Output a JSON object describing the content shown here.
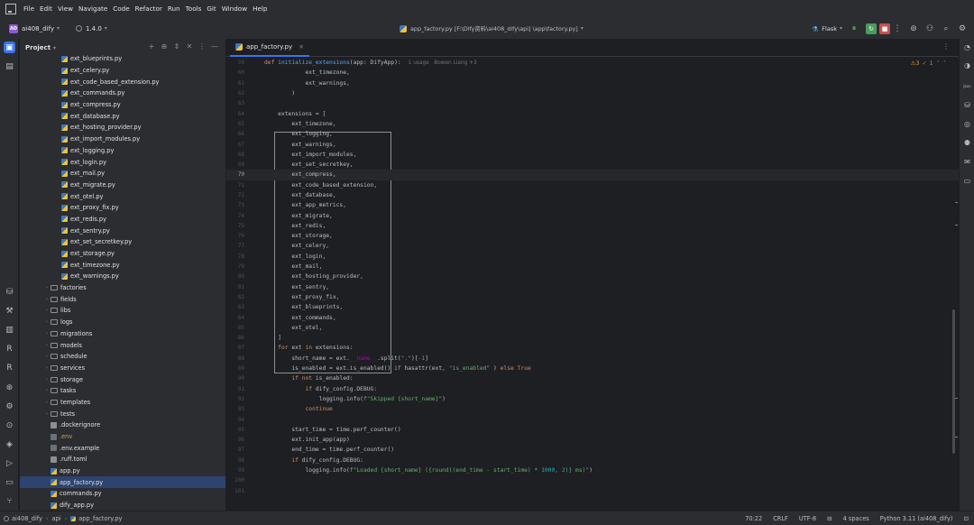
{
  "menu": [
    "File",
    "Edit",
    "View",
    "Navigate",
    "Code",
    "Refactor",
    "Run",
    "Tools",
    "Git",
    "Window",
    "Help"
  ],
  "project": {
    "badge": "AD",
    "name": "ai408_dify",
    "branch": "1.4.0"
  },
  "title_path": "app_factory.py [F:\\Dify资料\\ai408_dify\\api] \\app\\factory.py]",
  "run_config": "Flask",
  "panel": {
    "title": "Project"
  },
  "tree": [
    {
      "label": "ext_blueprints.py",
      "type": "py",
      "depth": 3
    },
    {
      "label": "ext_celery.py",
      "type": "py",
      "depth": 3
    },
    {
      "label": "ext_code_based_extension.py",
      "type": "py",
      "depth": 3
    },
    {
      "label": "ext_commands.py",
      "type": "py",
      "depth": 3
    },
    {
      "label": "ext_compress.py",
      "type": "py",
      "depth": 3
    },
    {
      "label": "ext_database.py",
      "type": "py",
      "depth": 3
    },
    {
      "label": "ext_hosting_provider.py",
      "type": "py",
      "depth": 3
    },
    {
      "label": "ext_import_modules.py",
      "type": "py",
      "depth": 3
    },
    {
      "label": "ext_logging.py",
      "type": "py",
      "depth": 3
    },
    {
      "label": "ext_login.py",
      "type": "py",
      "depth": 3
    },
    {
      "label": "ext_mail.py",
      "type": "py",
      "depth": 3
    },
    {
      "label": "ext_migrate.py",
      "type": "py",
      "depth": 3
    },
    {
      "label": "ext_otel.py",
      "type": "py",
      "depth": 3
    },
    {
      "label": "ext_proxy_fix.py",
      "type": "py",
      "depth": 3
    },
    {
      "label": "ext_redis.py",
      "type": "py",
      "depth": 3
    },
    {
      "label": "ext_sentry.py",
      "type": "py",
      "depth": 3
    },
    {
      "label": "ext_set_secretkey.py",
      "type": "py",
      "depth": 3
    },
    {
      "label": "ext_storage.py",
      "type": "py",
      "depth": 3
    },
    {
      "label": "ext_timezone.py",
      "type": "py",
      "depth": 3
    },
    {
      "label": "ext_warnings.py",
      "type": "py",
      "depth": 3
    },
    {
      "label": "factories",
      "type": "folder",
      "depth": 2
    },
    {
      "label": "fields",
      "type": "folder",
      "depth": 2
    },
    {
      "label": "libs",
      "type": "folder",
      "depth": 2
    },
    {
      "label": "logs",
      "type": "folder",
      "depth": 2
    },
    {
      "label": "migrations",
      "type": "folder",
      "depth": 2
    },
    {
      "label": "models",
      "type": "folder",
      "depth": 2
    },
    {
      "label": "schedule",
      "type": "folder",
      "depth": 2
    },
    {
      "label": "services",
      "type": "folder",
      "depth": 2
    },
    {
      "label": "storage",
      "type": "folder",
      "depth": 2
    },
    {
      "label": "tasks",
      "type": "folder",
      "depth": 2
    },
    {
      "label": "templates",
      "type": "folder",
      "depth": 2
    },
    {
      "label": "tests",
      "type": "folder",
      "depth": 2
    },
    {
      "label": ".dockerignore",
      "type": "git",
      "depth": 2
    },
    {
      "label": ".env",
      "type": "env",
      "depth": 2,
      "orange": true
    },
    {
      "label": ".env.example",
      "type": "env",
      "depth": 2
    },
    {
      "label": ".ruff.toml",
      "type": "toml",
      "depth": 2
    },
    {
      "label": "app.py",
      "type": "py",
      "depth": 2
    },
    {
      "label": "app_factory.py",
      "type": "py",
      "depth": 2,
      "selected": true
    },
    {
      "label": "commands.py",
      "type": "py",
      "depth": 2
    },
    {
      "label": "dify_app.py",
      "type": "py",
      "depth": 2
    }
  ],
  "editor": {
    "tab": "app_factory.py",
    "warnings": "3",
    "checks": "1",
    "current_line": "70",
    "lines": [
      {
        "n": "59",
        "segs": [
          [
            "kw",
            "def "
          ],
          [
            "fn",
            "initialize_extensions"
          ],
          [
            "",
            "(app: DifyApp):"
          ]
        ],
        "hint": "1 usage   Bowen Liang +3"
      },
      {
        "n": "60",
        "segs": [
          [
            "",
            "            ext_timezone,"
          ]
        ]
      },
      {
        "n": "61",
        "segs": [
          [
            "",
            "            ext_warnings,"
          ]
        ]
      },
      {
        "n": "62",
        "segs": [
          [
            "",
            "        )"
          ]
        ]
      },
      {
        "n": "63",
        "segs": []
      },
      {
        "n": "64",
        "segs": [
          [
            "",
            "    extensions = ["
          ]
        ]
      },
      {
        "n": "65",
        "segs": [
          [
            "",
            "        ext_timezone,"
          ]
        ]
      },
      {
        "n": "66",
        "segs": [
          [
            "",
            "        ext_logging,"
          ]
        ]
      },
      {
        "n": "67",
        "segs": [
          [
            "",
            "        ext_warnings,"
          ]
        ]
      },
      {
        "n": "68",
        "segs": [
          [
            "",
            "        ext_import_modules,"
          ]
        ]
      },
      {
        "n": "69",
        "segs": [
          [
            "",
            "        ext_set_secretkey,"
          ]
        ]
      },
      {
        "n": "70",
        "segs": [
          [
            "",
            "        ext_compress,"
          ]
        ]
      },
      {
        "n": "71",
        "segs": [
          [
            "",
            "        ext_code_based_extension,"
          ]
        ]
      },
      {
        "n": "72",
        "segs": [
          [
            "",
            "        ext_database,"
          ]
        ]
      },
      {
        "n": "73",
        "segs": [
          [
            "",
            "        ext_app_metrics,"
          ]
        ]
      },
      {
        "n": "74",
        "segs": [
          [
            "",
            "        ext_migrate,"
          ]
        ]
      },
      {
        "n": "75",
        "segs": [
          [
            "",
            "        ext_redis,"
          ]
        ]
      },
      {
        "n": "76",
        "segs": [
          [
            "",
            "        ext_storage,"
          ]
        ]
      },
      {
        "n": "77",
        "segs": [
          [
            "",
            "        ext_celery,"
          ]
        ]
      },
      {
        "n": "78",
        "segs": [
          [
            "",
            "        ext_login,"
          ]
        ]
      },
      {
        "n": "79",
        "segs": [
          [
            "",
            "        ext_mail,"
          ]
        ]
      },
      {
        "n": "80",
        "segs": [
          [
            "",
            "        ext_hosting_provider,"
          ]
        ]
      },
      {
        "n": "81",
        "segs": [
          [
            "",
            "        ext_sentry,"
          ]
        ]
      },
      {
        "n": "82",
        "segs": [
          [
            "",
            "        ext_proxy_fix,"
          ]
        ]
      },
      {
        "n": "83",
        "segs": [
          [
            "",
            "        ext_blueprints,"
          ]
        ]
      },
      {
        "n": "84",
        "segs": [
          [
            "",
            "        ext_commands,"
          ]
        ]
      },
      {
        "n": "85",
        "segs": [
          [
            "",
            "        ext_otel,"
          ]
        ]
      },
      {
        "n": "86",
        "segs": [
          [
            "",
            "    ]"
          ]
        ]
      },
      {
        "n": "87",
        "segs": [
          [
            "kw",
            "    for "
          ],
          [
            "",
            "ext "
          ],
          [
            "kw",
            "in "
          ],
          [
            "",
            "extensions:"
          ]
        ]
      },
      {
        "n": "88",
        "segs": [
          [
            "",
            "        short_name = ext."
          ],
          [
            "dunder",
            "__name__"
          ],
          [
            "",
            ".split("
          ],
          [
            "str",
            "\".\""
          ],
          [
            "",
            ")["
          ],
          [
            "num",
            "-1"
          ],
          [
            "",
            "]"
          ]
        ]
      },
      {
        "n": "89",
        "segs": [
          [
            "",
            "        is_enabled = ext.is_enabled() "
          ],
          [
            "kw",
            "if "
          ],
          [
            "",
            "hasattr(ext, "
          ],
          [
            "str",
            "\"is_enabled\""
          ],
          [
            "",
            " ) "
          ],
          [
            "kw",
            "else "
          ],
          [
            "kw",
            "True"
          ]
        ]
      },
      {
        "n": "90",
        "segs": [
          [
            "kw",
            "        if not "
          ],
          [
            "",
            "is_enabled:"
          ]
        ]
      },
      {
        "n": "91",
        "segs": [
          [
            "kw",
            "            if "
          ],
          [
            "",
            "dify_config.DEBUG:"
          ]
        ]
      },
      {
        "n": "92",
        "segs": [
          [
            "",
            "                logging.info("
          ],
          [
            "str",
            "f\"Skipped {short_name}\""
          ],
          [
            "",
            ")"
          ]
        ]
      },
      {
        "n": "93",
        "segs": [
          [
            "kw",
            "            continue"
          ]
        ]
      },
      {
        "n": "94",
        "segs": []
      },
      {
        "n": "95",
        "segs": [
          [
            "",
            "        start_time = time.perf_counter()"
          ]
        ]
      },
      {
        "n": "96",
        "segs": [
          [
            "",
            "        ext.init_app(app)"
          ]
        ]
      },
      {
        "n": "97",
        "segs": [
          [
            "",
            "        end_time = time.perf_counter()"
          ]
        ]
      },
      {
        "n": "98",
        "segs": [
          [
            "kw",
            "        if "
          ],
          [
            "",
            "dify_config.DEBUG:"
          ]
        ]
      },
      {
        "n": "99",
        "segs": [
          [
            "",
            "            logging.info("
          ],
          [
            "str",
            "f\"Loaded {short_name} ({round((end_time - start_time) * "
          ],
          [
            "num",
            "1000"
          ],
          [
            "str",
            ", "
          ],
          [
            "num",
            "2"
          ],
          [
            "str",
            ")} ms)\""
          ],
          [
            "",
            ")"
          ]
        ]
      },
      {
        "n": "100",
        "segs": []
      },
      {
        "n": "101",
        "segs": []
      }
    ]
  },
  "status": {
    "crumbs": [
      "ai408_dify",
      "api",
      "app_factory.py"
    ],
    "position": "70:22",
    "line_sep": "CRLF",
    "encoding": "UTF-8",
    "indent": "4 spaces",
    "interpreter": "Python 3.11 (ai408_dify)"
  }
}
